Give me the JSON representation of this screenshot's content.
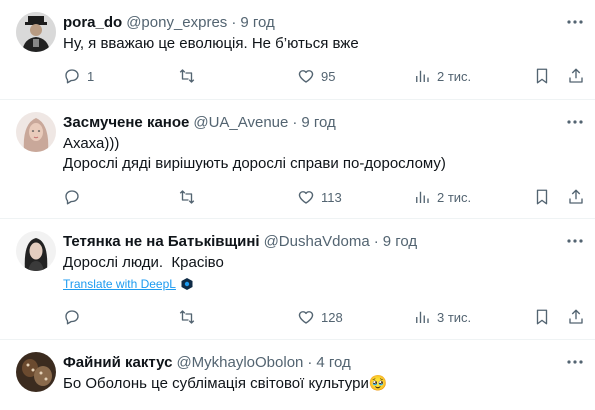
{
  "colors": {
    "text": "#0f1419",
    "muted": "#536471",
    "link": "#1d9bf0",
    "divider": "#eff3f4"
  },
  "tweets": [
    {
      "name": "pora_do",
      "handle": "@pony_expres",
      "dot": "·",
      "time": "9 год",
      "text": [
        "Ну, я вважаю це еволюція. Не б’ються вже"
      ],
      "reply_count": "1",
      "retweet_count": "",
      "like_count": "95",
      "view_count": "2 тис."
    },
    {
      "name": "Засмучене каное",
      "handle": "@UA_Avenue",
      "dot": "·",
      "time": "9 год",
      "text": [
        "Ахаха)))",
        "Дорослі дяді вирішують дорослі справи по-дорослому)"
      ],
      "reply_count": "",
      "retweet_count": "",
      "like_count": "113",
      "view_count": "2 тис."
    },
    {
      "name": "Тетянка не на Батьківщині",
      "handle": "@DushaVdoma",
      "dot": "·",
      "time": "9 год",
      "text": [
        "Дорослі люди.  Красіво"
      ],
      "translate": "Translate with DeepL",
      "reply_count": "",
      "retweet_count": "",
      "like_count": "128",
      "view_count": "3 тис."
    },
    {
      "name": "Файний кактус",
      "handle": "@MykhayloObolon",
      "dot": "·",
      "time": "4 год",
      "text": [
        "Бо Оболонь це сублімація світової культури🥹"
      ]
    }
  ]
}
